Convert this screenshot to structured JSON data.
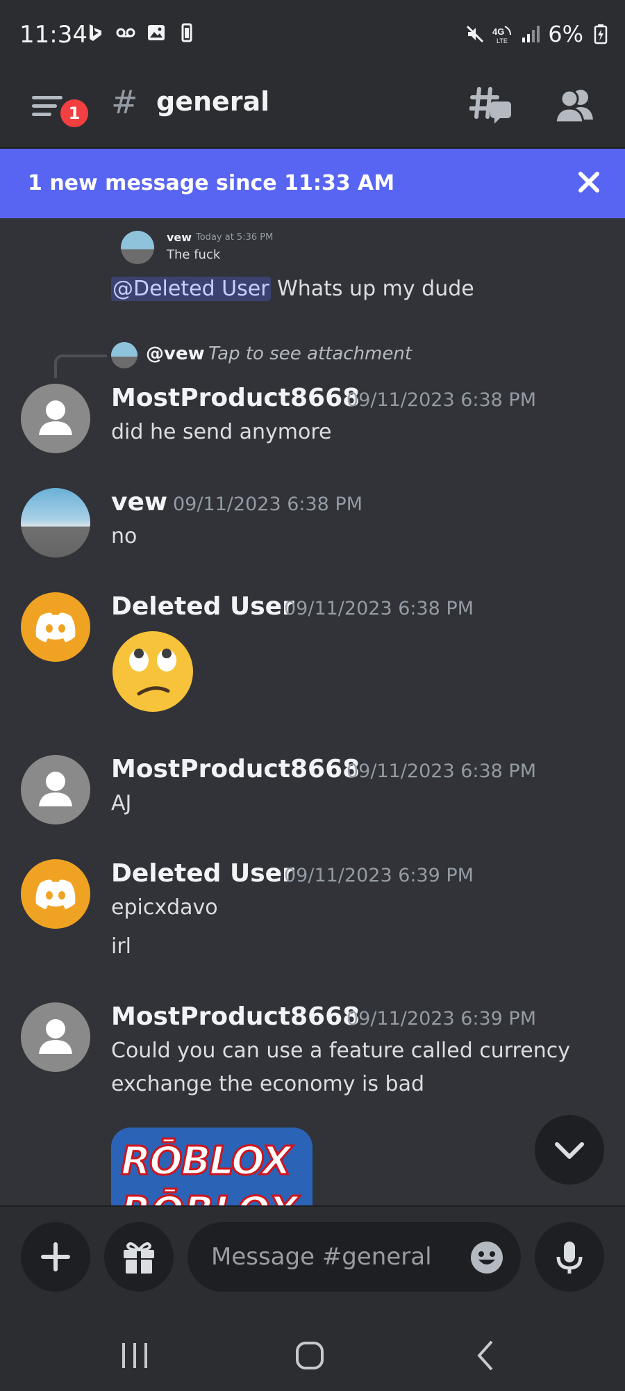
{
  "status_bar": {
    "time": "11:34",
    "battery": "6%",
    "network": "4G"
  },
  "header": {
    "hash": "#",
    "channel_name": "general",
    "menu_badge": "1"
  },
  "new_banner": {
    "text": "1 new message since 11:33 AM"
  },
  "reply_preview_top": {
    "name": "vew",
    "time": "Today at 5:36 PM",
    "text": "The fuck"
  },
  "mention_message": {
    "mention": "@Deleted User",
    "text": " Whats up my dude"
  },
  "reply_ref": {
    "name": "@vew",
    "attachment_text": "Tap to see attachment"
  },
  "messages": [
    {
      "author": "MostProduct8668",
      "time": "09/11/2023 6:38 PM",
      "lines": [
        "did he send anymore"
      ]
    },
    {
      "author": "vew",
      "time": "09/11/2023 6:38 PM",
      "lines": [
        "no"
      ]
    },
    {
      "author": "Deleted User",
      "time": "09/11/2023 6:38 PM",
      "lines": []
    },
    {
      "author": "MostProduct8668",
      "time": "09/11/2023 6:38 PM",
      "lines": [
        "AJ"
      ]
    },
    {
      "author": "Deleted User",
      "time": "09/11/2023 6:39 PM",
      "lines": [
        "epicxdavo",
        "irl"
      ]
    },
    {
      "author": "MostProduct8668",
      "time": "09/11/2023 6:39 PM",
      "lines": [
        "Could you can use a feature called currency",
        "exchange the economy is bad"
      ]
    }
  ],
  "attachment": {
    "logo_text": "RŌBLOX"
  },
  "composer": {
    "placeholder": "Message #general"
  },
  "icons": {
    "menu": "hamburger-menu-icon",
    "threads": "threads-icon",
    "members": "members-icon",
    "close": "close-icon",
    "add": "plus-icon",
    "gift": "gift-icon",
    "emoji": "emoji-icon",
    "mic": "microphone-icon",
    "scroll": "chevron-down-icon"
  },
  "colors": {
    "background": "#313338",
    "header": "#2b2d31",
    "banner": "#5865f2",
    "mention_bg": "#3c4270",
    "badge": "#f23f42",
    "deleted_user_avatar": "#f0a323"
  }
}
